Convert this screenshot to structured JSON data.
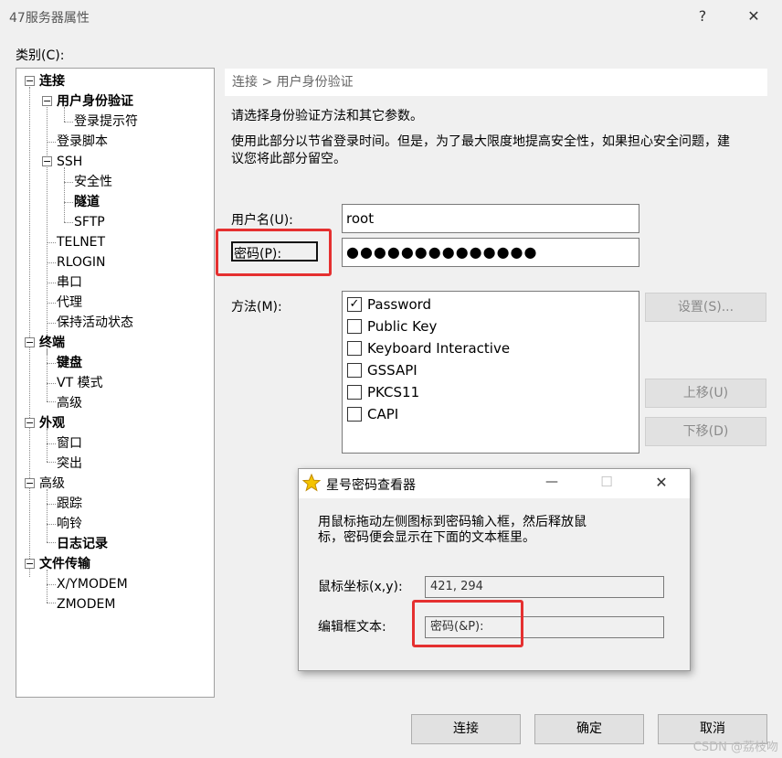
{
  "window": {
    "title": "47服务器属性",
    "help_glyph": "?",
    "close_glyph": "✕"
  },
  "category_label": "类别(C):",
  "tree": {
    "conn": "连接",
    "auth": "用户身份验证",
    "login_prompt": "登录提示符",
    "login_script": "登录脚本",
    "ssh": "SSH",
    "security": "安全性",
    "tunnel": "隧道",
    "sftp": "SFTP",
    "telnet": "TELNET",
    "rlogin": "RLOGIN",
    "serial": "串口",
    "proxy": "代理",
    "keepalive": "保持活动状态",
    "terminal": "终端",
    "keyboard": "键盘",
    "vt_mode": "VT 模式",
    "terminal_adv": "高级",
    "appearance": "外观",
    "window": "窗口",
    "highlight": "突出",
    "advanced": "高级",
    "trace": "跟踪",
    "bell": "响铃",
    "logging": "日志记录",
    "file_transfer": "文件传输",
    "xymodem": "X/YMODEM",
    "zmodem": "ZMODEM",
    "expander_minus": "−"
  },
  "breadcrumb": "连接 > 用户身份验证",
  "desc": {
    "line1": "请选择身份验证方法和其它参数。",
    "line2": "使用此部分以节省登录时间。但是，为了最大限度地提高安全性，如果担心安全问题，建",
    "line3": "议您将此部分留空。"
  },
  "form": {
    "username_label": "用户名(U):",
    "username_value": "root",
    "password_label": "密码(P):",
    "password_value": "●●●●●●●●●●●●●●",
    "method_label": "方法(M):",
    "methods": [
      {
        "label": "Password",
        "mark": "✓"
      },
      {
        "label": "Public Key",
        "mark": ""
      },
      {
        "label": "Keyboard Interactive",
        "mark": ""
      },
      {
        "label": "GSSAPI",
        "mark": ""
      },
      {
        "label": "PKCS11",
        "mark": ""
      },
      {
        "label": "CAPI",
        "mark": ""
      }
    ],
    "settings_button": "设置(S)...",
    "move_up_button": "上移(U)",
    "move_down_button": "下移(D)"
  },
  "popup": {
    "title": "星号密码查看器",
    "minimize_glyph": "—",
    "maximize_glyph": "☐",
    "close_glyph": "✕",
    "instruction_line1": "用鼠标拖动左侧图标到密码输入框，然后释放鼠",
    "instruction_line2": "标，密码便会显示在下面的文本框里。",
    "coord_label": "鼠标坐标(x,y):",
    "coord_value": "421, 294",
    "edit_text_label": "编辑框文本:",
    "edit_text_value": "密码(&P):"
  },
  "buttons": {
    "connect": "连接",
    "ok": "确定",
    "cancel": "取消"
  },
  "watermark": "CSDN @荔枝吻",
  "colors": {
    "highlight_red": "#e53030",
    "star_yellow": "#f5c400"
  }
}
